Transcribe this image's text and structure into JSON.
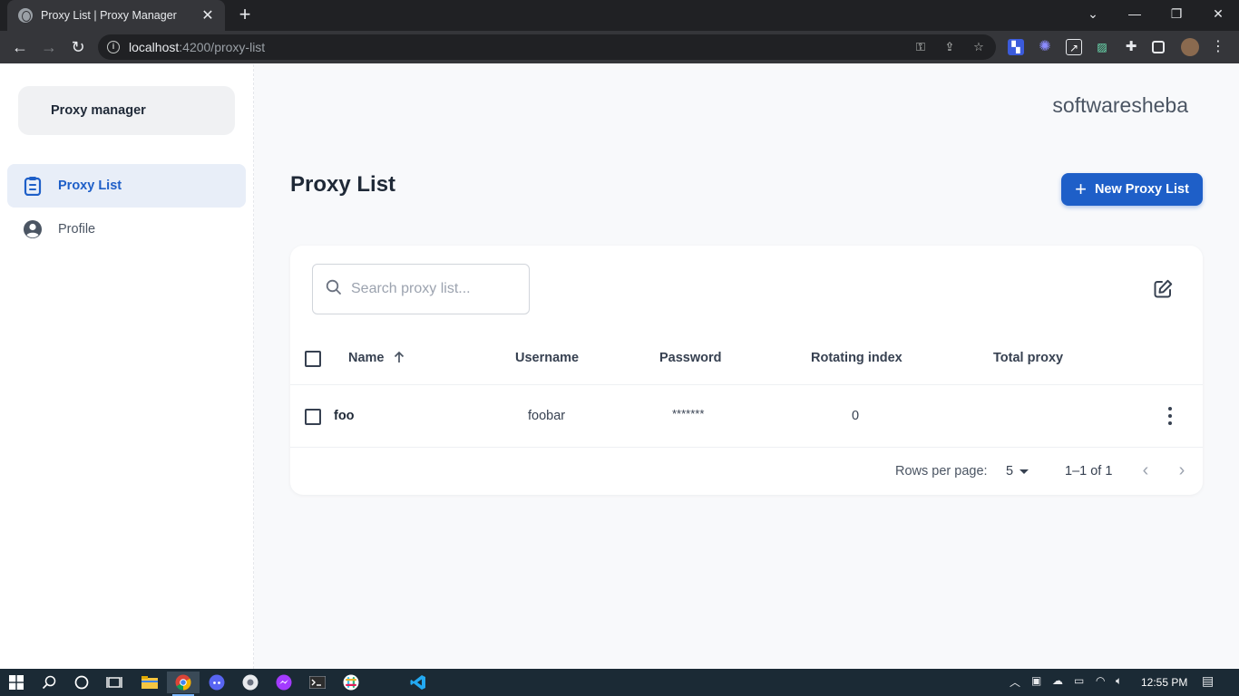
{
  "browser": {
    "tab_title": "Proxy List | Proxy Manager",
    "url_host": "localhost",
    "url_rest": ":4200/proxy-list"
  },
  "sidebar": {
    "brand": "Proxy manager",
    "items": [
      {
        "label": "Proxy List",
        "icon": "clipboard-list-icon",
        "active": true
      },
      {
        "label": "Profile",
        "icon": "user-circle-icon",
        "active": false
      }
    ]
  },
  "header": {
    "user": "softwaresheba"
  },
  "main": {
    "title": "Proxy List",
    "new_button": "New Proxy List",
    "search_placeholder": "Search proxy list...",
    "columns": [
      "Name",
      "Username",
      "Password",
      "Rotating index",
      "Total proxy"
    ],
    "rows": [
      {
        "name": "foo",
        "username": "foobar",
        "password": "*******",
        "rotating_index": "0",
        "total_proxy": ""
      }
    ],
    "pagination": {
      "rows_per_page_label": "Rows per page:",
      "rows_per_page": "5",
      "range": "1–1 of 1"
    }
  },
  "taskbar": {
    "time": "12:55 PM"
  },
  "colors": {
    "accent": "#1e5fc8",
    "active_nav_bg": "#e8eef8"
  }
}
